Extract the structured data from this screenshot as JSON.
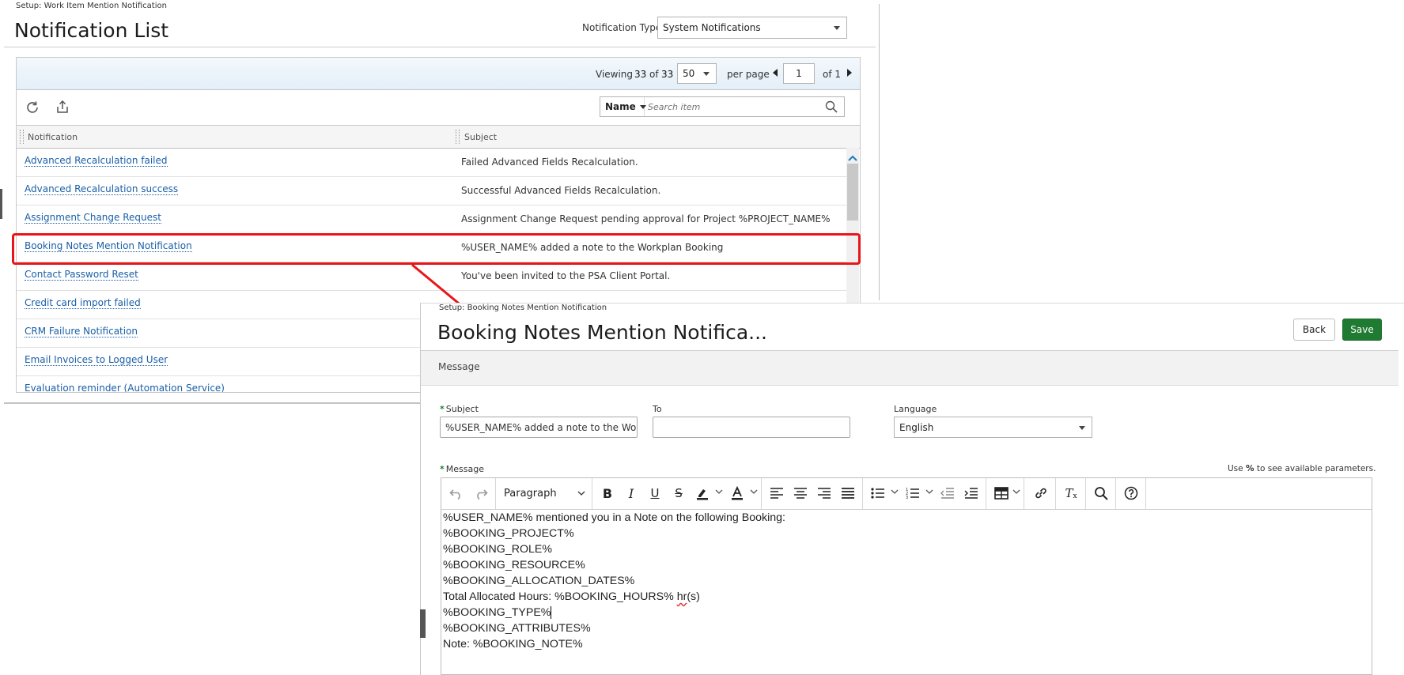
{
  "list_page": {
    "breadcrumb": "Setup: Work Item Mention Notification",
    "title": "Notification List",
    "notification_type_label": "Notification Type",
    "notification_type_value": "System Notifications",
    "pager": {
      "viewing_label": "Viewing",
      "viewing_count": "33",
      "of_label": "of",
      "total": "33",
      "page_size": "50",
      "per_page_label": "per page",
      "page": "1",
      "of_pages": "of 1"
    },
    "search": {
      "field": "Name",
      "placeholder": "Search item"
    },
    "columns": {
      "notification": "Notification",
      "subject": "Subject"
    },
    "rows": [
      {
        "name": "Advanced Recalculation failed",
        "subject": "Failed Advanced Fields Recalculation."
      },
      {
        "name": "Advanced Recalculation success",
        "subject": "Successful Advanced Fields Recalculation."
      },
      {
        "name": "Assignment Change Request",
        "subject": "Assignment Change Request pending approval for Project %PROJECT_NAME%"
      },
      {
        "name": "Booking Notes Mention Notification",
        "subject": "%USER_NAME% added a note to the Workplan Booking"
      },
      {
        "name": "Contact Password Reset",
        "subject": "You've been invited to the PSA Client Portal."
      },
      {
        "name": "Credit card import failed",
        "subject": ""
      },
      {
        "name": "CRM Failure Notification",
        "subject": ""
      },
      {
        "name": "Email Invoices to Logged User",
        "subject": ""
      },
      {
        "name": "Evaluation reminder (Automation Service)",
        "subject": ""
      }
    ]
  },
  "edit_page": {
    "breadcrumb": "Setup: Booking Notes Mention Notification",
    "title": "Booking Notes Mention Notifica...",
    "back_label": "Back",
    "save_label": "Save",
    "section_label": "Message",
    "subject_label": "Subject",
    "subject_value": "%USER_NAME% added a note to the Workplan Booking",
    "to_label": "To",
    "to_value": "",
    "language_label": "Language",
    "language_value": "English",
    "message_label": "Message",
    "hint_prefix": "Use",
    "hint_symbol": "%",
    "hint_suffix": "to see available parameters.",
    "paragraph_format": "Paragraph",
    "message_lines": [
      "%USER_NAME% mentioned you in a Note on the following Booking:",
      "%BOOKING_PROJECT%",
      "%BOOKING_ROLE%",
      "%BOOKING_RESOURCE%",
      "%BOOKING_ALLOCATION_DATES%",
      "Total Allocated Hours: %BOOKING_HOURS% hr(s)",
      "%BOOKING_TYPE%",
      "%BOOKING_ATTRIBUTES%",
      "Note: %BOOKING_NOTE%"
    ],
    "hours_prefix": "Total Allocated Hours: %BOOKING_HOURS% ",
    "hours_unit": "hr",
    "hours_suffix": "(s)"
  },
  "colors": {
    "link": "#1a5fa8",
    "highlight": "#e8161a",
    "save_button": "#1f7a32",
    "required_marker": "#1f7a32"
  },
  "icons": [
    "refresh-icon",
    "export-icon",
    "search-icon",
    "caret-down-icon",
    "arrow-left-icon",
    "arrow-right-icon",
    "undo-icon",
    "redo-icon",
    "bold-icon",
    "italic-icon",
    "underline-icon",
    "strikethrough-icon",
    "highlight-color-icon",
    "text-color-icon",
    "align-left-icon",
    "align-center-icon",
    "align-right-icon",
    "justify-icon",
    "bullet-list-icon",
    "numbered-list-icon",
    "outdent-icon",
    "indent-icon",
    "table-icon",
    "link-icon",
    "clear-formatting-icon",
    "find-icon",
    "help-icon"
  ]
}
